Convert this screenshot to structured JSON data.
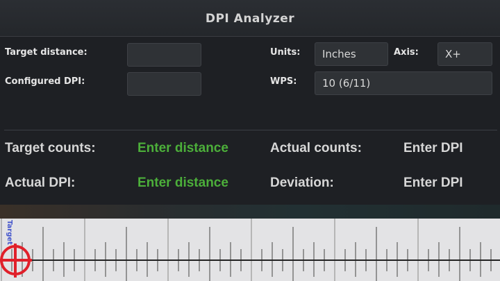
{
  "app": {
    "title": "DPI Analyzer"
  },
  "form": {
    "target_distance_label": "Target distance:",
    "target_distance_value": "",
    "configured_dpi_label": "Configured DPI:",
    "configured_dpi_value": "",
    "units_label": "Units:",
    "units_value": "Inches",
    "axis_label": "Axis:",
    "axis_value": "X+",
    "wps_label": "WPS:",
    "wps_value": "10 (6/11)"
  },
  "results": {
    "target_counts_label": "Target counts:",
    "target_counts_value": "Enter distance",
    "actual_counts_label": "Actual counts:",
    "actual_counts_value": "Enter DPI",
    "actual_dpi_label": "Actual DPI:",
    "actual_dpi_value": "Enter distance",
    "deviation_label": "Deviation:",
    "deviation_value": "Enter DPI"
  },
  "ruler": {
    "target_label": "Target",
    "accent_color": "#e0202a"
  }
}
